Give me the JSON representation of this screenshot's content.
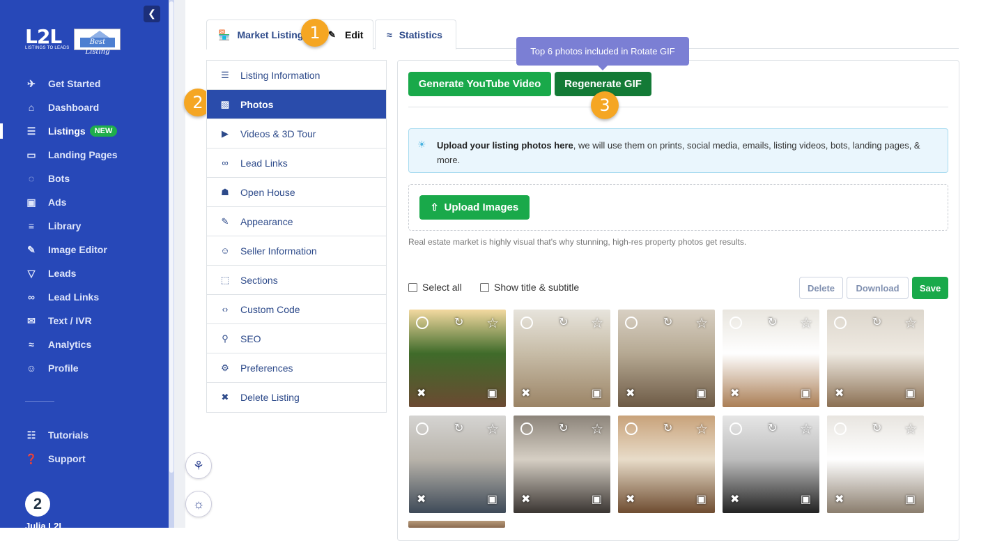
{
  "sidebar": {
    "collapse_icon": "chevron-left-icon",
    "logo_text": "L2L",
    "logo_sub": "LISTINGS TO LEADS",
    "partner_logo": "Best Listing",
    "items": [
      {
        "label": "Get Started",
        "icon": "rocket-icon"
      },
      {
        "label": "Dashboard",
        "icon": "home-icon"
      },
      {
        "label": "Listings",
        "icon": "list-icon",
        "badge": "NEW",
        "active": true
      },
      {
        "label": "Landing Pages",
        "icon": "window-icon"
      },
      {
        "label": "Bots",
        "icon": "chat-icon"
      },
      {
        "label": "Ads",
        "icon": "ad-icon"
      },
      {
        "label": "Library",
        "icon": "stack-icon"
      },
      {
        "label": "Image Editor",
        "icon": "brush-icon"
      },
      {
        "label": "Leads",
        "icon": "filter-icon"
      },
      {
        "label": "Lead Links",
        "icon": "link-icon"
      },
      {
        "label": "Text / IVR",
        "icon": "message-icon"
      },
      {
        "label": "Analytics",
        "icon": "chart-icon"
      },
      {
        "label": "Profile",
        "icon": "user-icon"
      }
    ],
    "secondary_items": [
      {
        "label": "Tutorials",
        "icon": "book-icon"
      },
      {
        "label": "Support",
        "icon": "help-icon"
      }
    ],
    "user_name": "Julia L2L",
    "avatar_text": "2"
  },
  "tabs": {
    "market_listing": "Market Listing",
    "edit": "Edit",
    "statistics": "Statistics"
  },
  "markers": [
    "1",
    "2",
    "3"
  ],
  "menu": [
    {
      "label": "Listing Information",
      "icon": "list-icon"
    },
    {
      "label": "Photos",
      "icon": "image-icon",
      "active": true
    },
    {
      "label": "Videos & 3D Tour",
      "icon": "video-icon"
    },
    {
      "label": "Lead Links",
      "icon": "link-icon"
    },
    {
      "label": "Open House",
      "icon": "building-icon"
    },
    {
      "label": "Appearance",
      "icon": "brush-icon"
    },
    {
      "label": "Seller Information",
      "icon": "user-icon"
    },
    {
      "label": "Sections",
      "icon": "layers-icon"
    },
    {
      "label": "Custom Code",
      "icon": "code-icon"
    },
    {
      "label": "SEO",
      "icon": "search-icon"
    },
    {
      "label": "Preferences",
      "icon": "gear-icon"
    },
    {
      "label": "Delete Listing",
      "icon": "trash-icon"
    }
  ],
  "photos_panel": {
    "generate_youtube_label": "Generate YouTube Video",
    "regenerate_gif_label": "Regenerate GIF",
    "tooltip": "Top 6 photos included in Rotate GIF",
    "info_bold": "Upload your listing photos here",
    "info_rest": ", we will use them on prints, social media, emails, listing videos, bots, landing pages, & more.",
    "upload_label": "Upload Images",
    "hint": "Real estate market is highly visual that's why stunning, high-res property photos get results.",
    "select_all": "Select all",
    "show_title": "Show title & subtitle",
    "delete_label": "Delete",
    "download_label": "Download",
    "save_label": "Save"
  },
  "photos": [
    {
      "scene": "house-exterior",
      "colors": [
        "#f3d9a0",
        "#6b4a32",
        "#3f6b2a"
      ]
    },
    {
      "scene": "living-room",
      "colors": [
        "#e7e4dc",
        "#9b8466",
        "#c7bca7"
      ]
    },
    {
      "scene": "living-room",
      "colors": [
        "#d8d0c3",
        "#6d5a45",
        "#b6a993"
      ]
    },
    {
      "scene": "kitchen",
      "colors": [
        "#e9e6df",
        "#aa7e55",
        "#ffffff"
      ]
    },
    {
      "scene": "living-room",
      "colors": [
        "#dcd6cc",
        "#8a6f52",
        "#efeae2"
      ]
    },
    {
      "scene": "dining-room",
      "colors": [
        "#d5d4d2",
        "#3e4a58",
        "#b8b3aa"
      ]
    },
    {
      "scene": "loft",
      "colors": [
        "#8c847a",
        "#3a3532",
        "#d6cfc4"
      ]
    },
    {
      "scene": "living-room",
      "colors": [
        "#c8a27a",
        "#6e4c30",
        "#e8dcc9"
      ]
    },
    {
      "scene": "kitchen",
      "colors": [
        "#e6e6e6",
        "#222222",
        "#bdbdbd"
      ]
    },
    {
      "scene": "kitchen",
      "colors": [
        "#e8e5e0",
        "#8a7d6d",
        "#ffffff"
      ]
    }
  ],
  "floating": [
    "accessibility-icon",
    "lightbulb-icon"
  ]
}
